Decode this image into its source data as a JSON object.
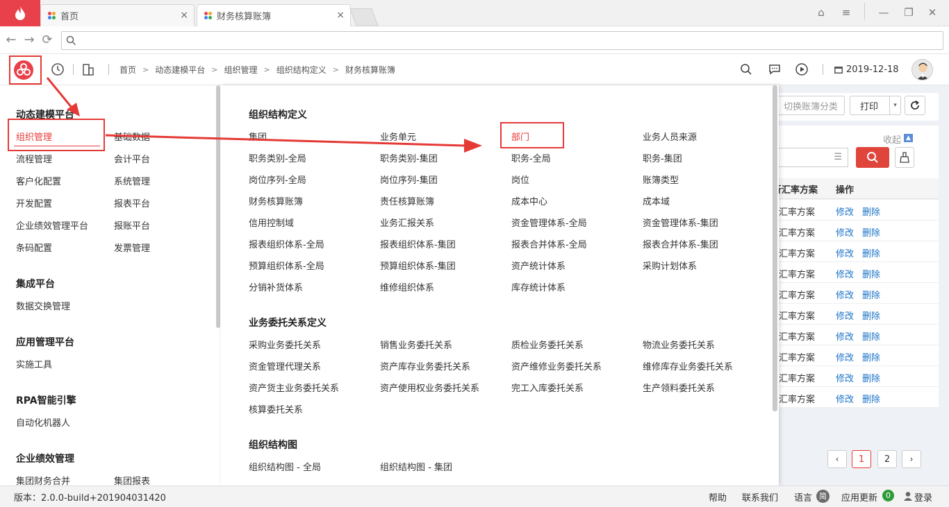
{
  "browser": {
    "tabs": [
      {
        "label": "首页"
      },
      {
        "label": "财务核算账簿"
      }
    ],
    "tab_close_glyph": "×",
    "window_controls": [
      "⌂",
      "≡",
      "—",
      "❐",
      "✕"
    ],
    "nav": {
      "back": "←",
      "forward": "→",
      "reload": "⟳"
    }
  },
  "toolbar": {
    "breadcrumb": [
      "首页",
      "动态建模平台",
      "组织管理",
      "组织结构定义",
      "财务核算账簿"
    ],
    "breadcrumb_sep": ">",
    "date": "2019-12-18"
  },
  "left_nav": {
    "groups": [
      {
        "title": "动态建模平台",
        "rows": [
          [
            "组织管理",
            "基础数据"
          ],
          [
            "流程管理",
            "会计平台"
          ],
          [
            "客户化配置",
            "系统管理"
          ],
          [
            "开发配置",
            "报表平台"
          ],
          [
            "企业绩效管理平台",
            "报账平台"
          ],
          [
            "条码配置",
            "发票管理"
          ]
        ]
      },
      {
        "title": "集成平台",
        "rows": [
          [
            "数据交换管理",
            ""
          ]
        ]
      },
      {
        "title": "应用管理平台",
        "rows": [
          [
            "实施工具",
            ""
          ]
        ]
      },
      {
        "title": "RPA智能引擎",
        "rows": [
          [
            "自动化机器人",
            ""
          ]
        ]
      },
      {
        "title": "企业绩效管理",
        "rows": [
          [
            "集团财务合并",
            "集团报表"
          ]
        ]
      }
    ]
  },
  "mega_menu": {
    "sections": [
      {
        "title": "组织结构定义",
        "rows": [
          [
            "集团",
            "业务单元",
            "部门",
            "业务人员来源"
          ],
          [
            "职务类别-全局",
            "职务类别-集团",
            "职务-全局",
            "职务-集团"
          ],
          [
            "岗位序列-全局",
            "岗位序列-集团",
            "岗位",
            "账簿类型"
          ],
          [
            "财务核算账簿",
            "责任核算账簿",
            "成本中心",
            "成本域"
          ],
          [
            "信用控制域",
            "业务汇报关系",
            "资金管理体系-全局",
            "资金管理体系-集团"
          ],
          [
            "报表组织体系-全局",
            "报表组织体系-集团",
            "报表合并体系-全局",
            "报表合并体系-集团"
          ],
          [
            "预算组织体系-全局",
            "预算组织体系-集团",
            "资产统计体系",
            "采购计划体系"
          ],
          [
            "分销补货体系",
            "维修组织体系",
            "库存统计体系",
            ""
          ]
        ]
      },
      {
        "title": "业务委托关系定义",
        "rows": [
          [
            "采购业务委托关系",
            "销售业务委托关系",
            "质检业务委托关系",
            "物流业务委托关系"
          ],
          [
            "资金管理代理关系",
            "资产库存业务委托关系",
            "资产维修业务委托关系",
            "维修库存业务委托关系"
          ],
          [
            "资产货主业务委托关系",
            "资产使用权业务委托关系",
            "完工入库委托关系",
            "生产领料委托关系"
          ],
          [
            "核算委托关系",
            "",
            "",
            ""
          ]
        ]
      },
      {
        "title": "组织结构图",
        "rows": [
          [
            "组织结构图 - 全局",
            "组织结构图 - 集团",
            "",
            ""
          ]
        ]
      }
    ]
  },
  "background_page": {
    "switch_button": "切换账簿分类",
    "print_button": "打印",
    "collapse_label": "收起",
    "col_scheme": "折汇率方案",
    "col_ops": "操作",
    "rows": [
      {
        "scheme": "汇率方案",
        "edit": "修改",
        "del": "删除"
      },
      {
        "scheme": "汇率方案",
        "edit": "修改",
        "del": "删除"
      },
      {
        "scheme": "汇率方案",
        "edit": "修改",
        "del": "删除"
      },
      {
        "scheme": "汇率方案",
        "edit": "修改",
        "del": "删除"
      },
      {
        "scheme": "汇率方案",
        "edit": "修改",
        "del": "删除"
      },
      {
        "scheme": "汇率方案",
        "edit": "修改",
        "del": "删除"
      },
      {
        "scheme": "汇率方案",
        "edit": "修改",
        "del": "删除"
      },
      {
        "scheme": "汇率方案",
        "edit": "修改",
        "del": "删除"
      },
      {
        "scheme": "汇率方案",
        "edit": "修改",
        "del": "删除"
      },
      {
        "scheme": "汇率方案",
        "edit": "修改",
        "del": "删除"
      }
    ],
    "pagination": {
      "prev": "‹",
      "next": "›",
      "pages": [
        "1",
        "2"
      ],
      "current": "1"
    }
  },
  "footer": {
    "version": "版本：2.0.0-build+201904031420",
    "help": "帮助",
    "contact": "联系我们",
    "language": "语言",
    "language_badge": "简",
    "updates": "应用更新",
    "update_count": "0",
    "login": "登录"
  },
  "colors": {
    "brand": "#e8414b",
    "highlight_red": "#e53935",
    "link": "#1a73c7",
    "update_green": "#2e9a3a"
  }
}
